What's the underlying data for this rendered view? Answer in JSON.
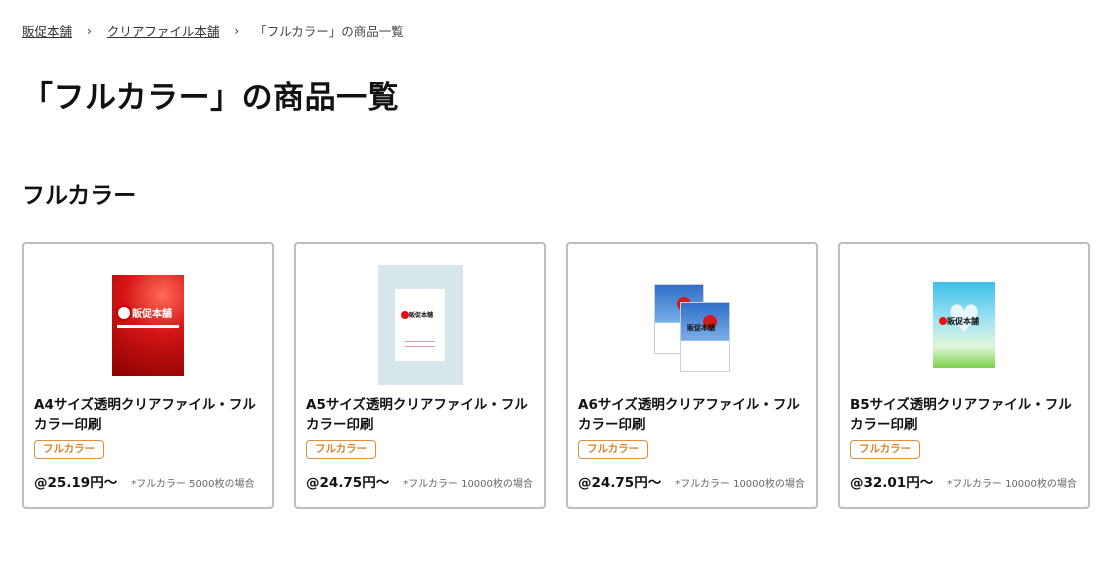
{
  "breadcrumb": {
    "items": [
      "販促本舗",
      "クリアファイル本舗",
      "「フルカラー」の商品一覧"
    ]
  },
  "page_title": "「フルカラー」の商品一覧",
  "section_title": "フルカラー",
  "products": [
    {
      "name": "A4サイズ透明クリアファイル・フルカラー印刷",
      "tag": "フルカラー",
      "price": "@25.19円〜",
      "note": "*フルカラー 5000枚の場合",
      "thumb_logo": "販促本舗"
    },
    {
      "name": "A5サイズ透明クリアファイル・フルカラー印刷",
      "tag": "フルカラー",
      "price": "@24.75円〜",
      "note": "*フルカラー 10000枚の場合",
      "thumb_logo": "販促本舗"
    },
    {
      "name": "A6サイズ透明クリアファイル・フルカラー印刷",
      "tag": "フルカラー",
      "price": "@24.75円〜",
      "note": "*フルカラー 10000枚の場合",
      "thumb_logo": "販促本舗"
    },
    {
      "name": "B5サイズ透明クリアファイル・フルカラー印刷",
      "tag": "フルカラー",
      "price": "@32.01円〜",
      "note": "*フルカラー 10000枚の場合",
      "thumb_logo": "販促本舗"
    }
  ],
  "colors": {
    "tag_border": "#e0903a",
    "tag_text": "#d9822b",
    "card_border": "#bdbdbd"
  }
}
